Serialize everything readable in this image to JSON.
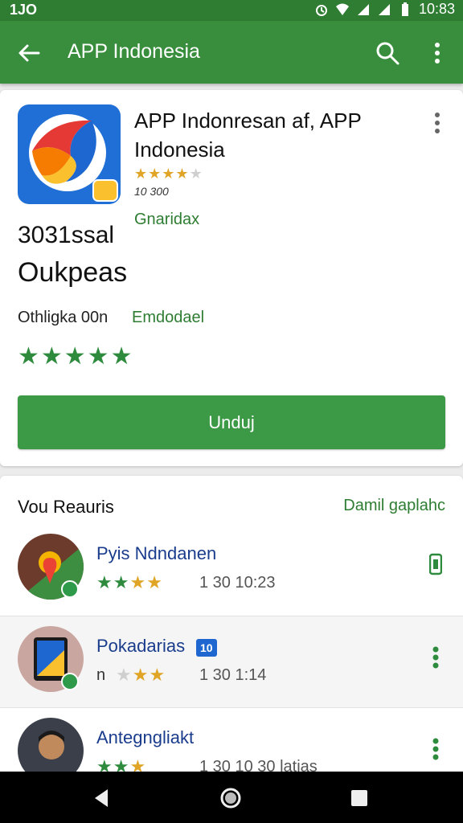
{
  "status_bar": {
    "left": "1JO",
    "time": "10:83"
  },
  "app_bar": {
    "title": "APP Indonesia"
  },
  "app": {
    "name": "APP Indonresan af, APP Indonesia",
    "small_rating_count": "10 300",
    "category": "Gnaridax",
    "label_1": "3031ssal",
    "label_2": "Oukpeas",
    "meta_left": "Othligka 00n",
    "meta_right": "Emdodael",
    "rating_stars": 4.5,
    "small_stars": 3.5,
    "install_label": "Unduj"
  },
  "section": {
    "title": "Vou Reauris",
    "link": "Damil gaplahc"
  },
  "apps": [
    {
      "name": "Pyis Ndndanen",
      "meta": "1 30 10:23",
      "stars": 3.5
    },
    {
      "name": "Pokadarias",
      "badge": "10",
      "prefix": "n",
      "meta": "1 30 1:14",
      "stars": 2.5
    },
    {
      "name": "Antegngliakt",
      "meta": "1 30 10 30 latias",
      "stars": 3
    }
  ],
  "colors": {
    "brand": "#388e3c",
    "status": "#2e7d32",
    "accent": "#3c9a47",
    "link": "#2e7d32"
  },
  "icons": [
    "back-arrow-icon",
    "search-icon",
    "more-vert-icon",
    "wifi-icon",
    "signal-icon",
    "battery-icon",
    "alarm-icon"
  ]
}
